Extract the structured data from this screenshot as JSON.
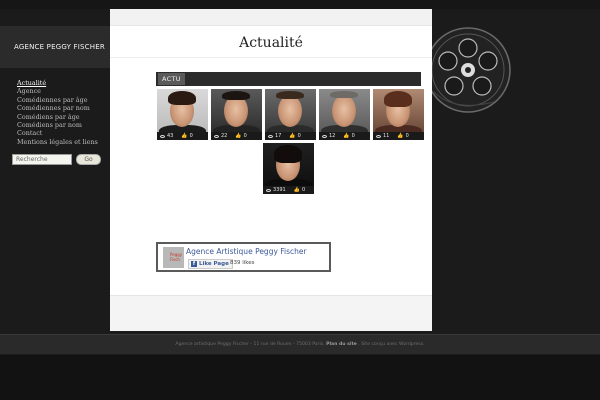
{
  "sidebar": {
    "site_title": "AGENCE PEGGY FISCHER",
    "nav": [
      {
        "label": "Actualité",
        "active": true
      },
      {
        "label": "Agence",
        "active": false
      },
      {
        "label": "Comédiennes par âge",
        "active": false
      },
      {
        "label": "Comédiennes par nom",
        "active": false
      },
      {
        "label": "Comédiens par âge",
        "active": false
      },
      {
        "label": "Comédiens par nom",
        "active": false
      },
      {
        "label": "Contact",
        "active": false
      },
      {
        "label": "Mentions légales et liens",
        "active": false
      }
    ],
    "search": {
      "placeholder": "Recherche",
      "button": "Go"
    }
  },
  "main": {
    "page_title": "Actualité",
    "category_tab": "ACTU",
    "thumbnails": [
      {
        "views": "43",
        "likes": "0"
      },
      {
        "views": "22",
        "likes": "0"
      },
      {
        "views": "17",
        "likes": "0"
      },
      {
        "views": "12",
        "likes": "0"
      },
      {
        "views": "11",
        "likes": "0"
      },
      {
        "views": "3391",
        "likes": "0"
      }
    ]
  },
  "facebook": {
    "page_name": "Agence Artistique Peggy Fischer",
    "logo_text": "Peggy Fisch",
    "like_label": "Like Page",
    "likes": "839 likes"
  },
  "footer": {
    "address": "Agence artistique Peggy Fischer - 11 rue de Rouen - 75003 Paris.",
    "sitemap": "Plan du site",
    "credit": ". Site conçu avec Wordpress."
  },
  "colors": {
    "background": "#1b1b1b",
    "content": "#ffffff",
    "fb_blue": "#3b5998"
  }
}
